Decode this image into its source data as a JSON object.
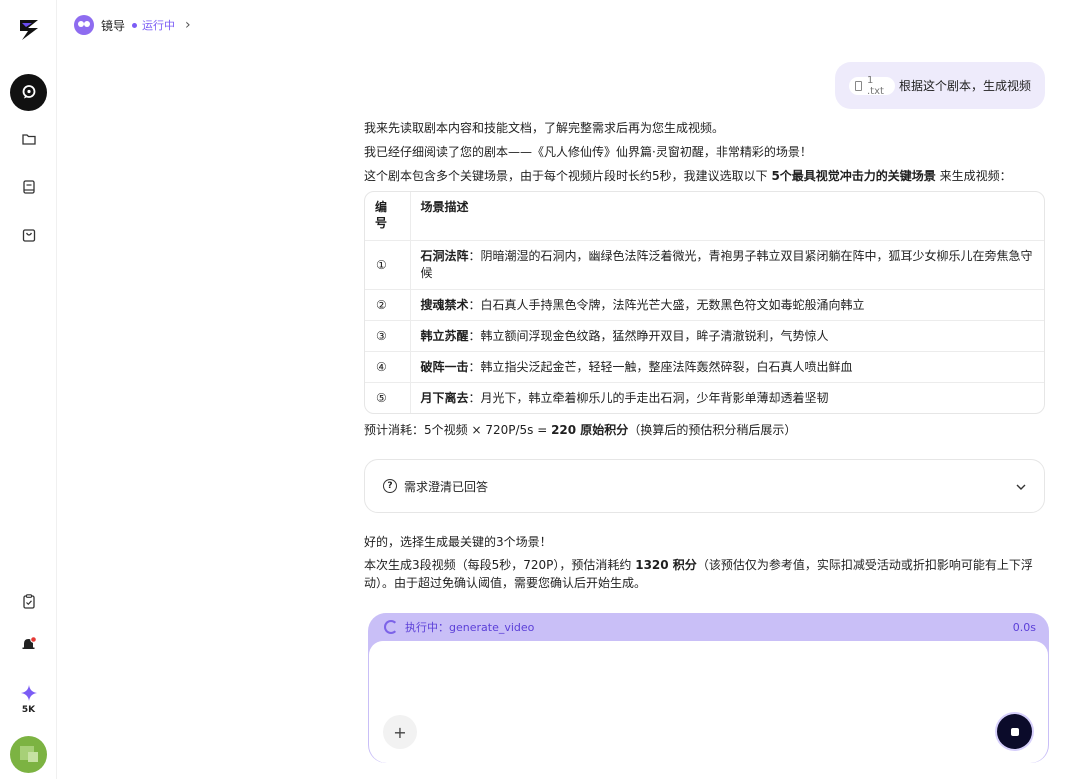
{
  "topbar": {
    "agent_name": "镜导",
    "status": "运行中",
    "chevron": "›"
  },
  "user_message": {
    "file_name": "1 .txt",
    "text": "根据这个剧本，生成视频"
  },
  "assistant": {
    "line1": "我来先读取剧本内容和技能文档，了解完整需求后再为您生成视频。",
    "line2": "我已经仔细阅读了您的剧本——《凡人修仙传》仙界篇·灵窗初醒，非常精彩的场景！",
    "line3_prefix": "这个剧本包含多个关键场景，由于每个视频片段时长约5秒，我建议选取以下 ",
    "line3_bold": "5个最具视觉冲击力的关键场景",
    "line3_suffix": " 来生成视频：",
    "table": {
      "headers": [
        "编号",
        "场景描述"
      ],
      "rows": [
        {
          "num": "①",
          "title": "石洞法阵",
          "desc": "：阴暗潮湿的石洞内，幽绿色法阵泛着微光，青袍男子韩立双目紧闭躺在阵中，狐耳少女柳乐儿在旁焦急守候"
        },
        {
          "num": "②",
          "title": "搜魂禁术",
          "desc": "：白石真人手持黑色令牌，法阵光芒大盛，无数黑色符文如毒蛇般涌向韩立"
        },
        {
          "num": "③",
          "title": "韩立苏醒",
          "desc": "：韩立额间浮现金色纹路，猛然睁开双目，眸子清澈锐利，气势惊人"
        },
        {
          "num": "④",
          "title": "破阵一击",
          "desc": "：韩立指尖泛起金芒，轻轻一触，整座法阵轰然碎裂，白石真人喷出鲜血"
        },
        {
          "num": "⑤",
          "title": "月下离去",
          "desc": "：月光下，韩立牵着柳乐儿的手走出石洞，少年背影单薄却透着坚韧"
        }
      ]
    },
    "cost_prefix": "预计消耗：5个视频 × 720P/5s = ",
    "cost_bold": "220 原始积分",
    "cost_suffix": "（换算后的预估积分稍后展示）",
    "clarify_label": "需求澄清已回答",
    "reply1": "好的，选择生成最关键的3个场景！",
    "reply2_prefix": "本次生成3段视频（每段5秒，720P），预估消耗约 ",
    "reply2_bold": "1320 积分",
    "reply2_suffix": "（该预估仅为参考值，实际扣减受活动或折扣影响可能有上下浮动）。由于超过免确认阈值，需要您确认后开始生成。"
  },
  "composer": {
    "exec_label": "执行中：generate_video",
    "exec_time": "0.0s",
    "plus": "+"
  },
  "sidebar": {
    "credit_label": "5K",
    "icons": [
      "logo-icon",
      "chat-icon",
      "folder-icon",
      "book-icon",
      "bag-icon",
      "clipboard-icon",
      "bell-icon",
      "sparkle-icon",
      "avatar"
    ]
  },
  "colors": {
    "accent": "#7b5cf5",
    "user_bubble": "#eeebfb",
    "exec_bar": "#c9bff7"
  }
}
